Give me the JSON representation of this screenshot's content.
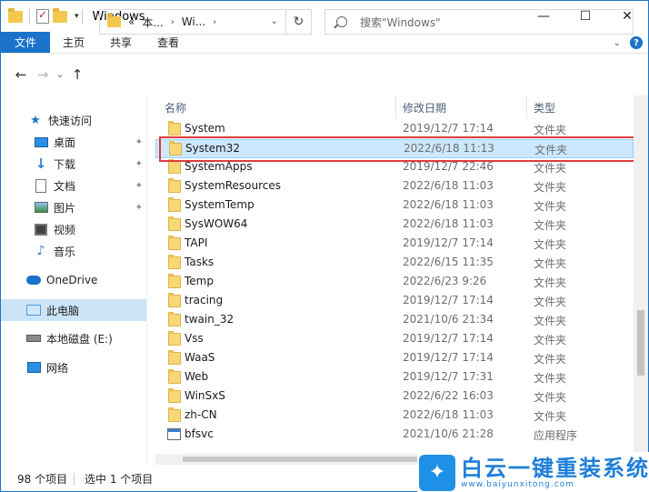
{
  "window": {
    "title": "Windows",
    "minimize": "—",
    "maximize": "☐",
    "close": "✕"
  },
  "ribbon": {
    "tabs": [
      "文件",
      "主页",
      "共享",
      "查看"
    ],
    "help": "?"
  },
  "address": {
    "overflow": "«",
    "segments": [
      "本...",
      "Wi..."
    ],
    "separator": "›",
    "search_placeholder": "搜索\"Windows\""
  },
  "nav": {
    "items": [
      {
        "label": "快速访问",
        "icon": "star-icon"
      },
      {
        "label": "桌面",
        "icon": "desktop-icon",
        "pinned": true
      },
      {
        "label": "下载",
        "icon": "download-icon",
        "pinned": true
      },
      {
        "label": "文档",
        "icon": "document-icon",
        "pinned": true
      },
      {
        "label": "图片",
        "icon": "picture-icon",
        "pinned": true
      },
      {
        "label": "视频",
        "icon": "video-icon"
      },
      {
        "label": "音乐",
        "icon": "music-icon"
      },
      {
        "label": "OneDrive",
        "icon": "cloud-icon"
      },
      {
        "label": "此电脑",
        "icon": "computer-icon",
        "selected": true
      },
      {
        "label": "本地磁盘 (E:)",
        "icon": "disk-icon"
      },
      {
        "label": "网络",
        "icon": "network-icon"
      }
    ]
  },
  "columns": {
    "name": "名称",
    "date": "修改日期",
    "type": "类型"
  },
  "files": [
    {
      "name": "System",
      "date": "2019/12/7 17:14",
      "type": "文件夹"
    },
    {
      "name": "System32",
      "date": "2022/6/18 11:13",
      "type": "文件夹",
      "selected": true
    },
    {
      "name": "SystemApps",
      "date": "2019/12/7 22:46",
      "type": "文件夹"
    },
    {
      "name": "SystemResources",
      "date": "2022/6/18 11:03",
      "type": "文件夹"
    },
    {
      "name": "SystemTemp",
      "date": "2022/6/18 11:03",
      "type": "文件夹"
    },
    {
      "name": "SysWOW64",
      "date": "2022/6/18 11:03",
      "type": "文件夹"
    },
    {
      "name": "TAPI",
      "date": "2019/12/7 17:14",
      "type": "文件夹"
    },
    {
      "name": "Tasks",
      "date": "2022/6/15 11:35",
      "type": "文件夹"
    },
    {
      "name": "Temp",
      "date": "2022/6/23 9:26",
      "type": "文件夹"
    },
    {
      "name": "tracing",
      "date": "2019/12/7 17:14",
      "type": "文件夹"
    },
    {
      "name": "twain_32",
      "date": "2021/10/6 21:34",
      "type": "文件夹"
    },
    {
      "name": "Vss",
      "date": "2019/12/7 17:14",
      "type": "文件夹"
    },
    {
      "name": "WaaS",
      "date": "2019/12/7 17:14",
      "type": "文件夹"
    },
    {
      "name": "Web",
      "date": "2019/12/7 17:31",
      "type": "文件夹"
    },
    {
      "name": "WinSxS",
      "date": "2022/6/22 16:03",
      "type": "文件夹"
    },
    {
      "name": "zh-CN",
      "date": "2022/6/18 11:03",
      "type": "文件夹"
    },
    {
      "name": "bfsvc",
      "date": "2021/10/6 21:28",
      "type": "应用程序",
      "app": true
    }
  ],
  "status": {
    "count": "98 个项目",
    "selected": "选中 1 个项目"
  },
  "watermark": {
    "title": "白云一键重装系统",
    "url": "www.baiyunxitong.com"
  }
}
